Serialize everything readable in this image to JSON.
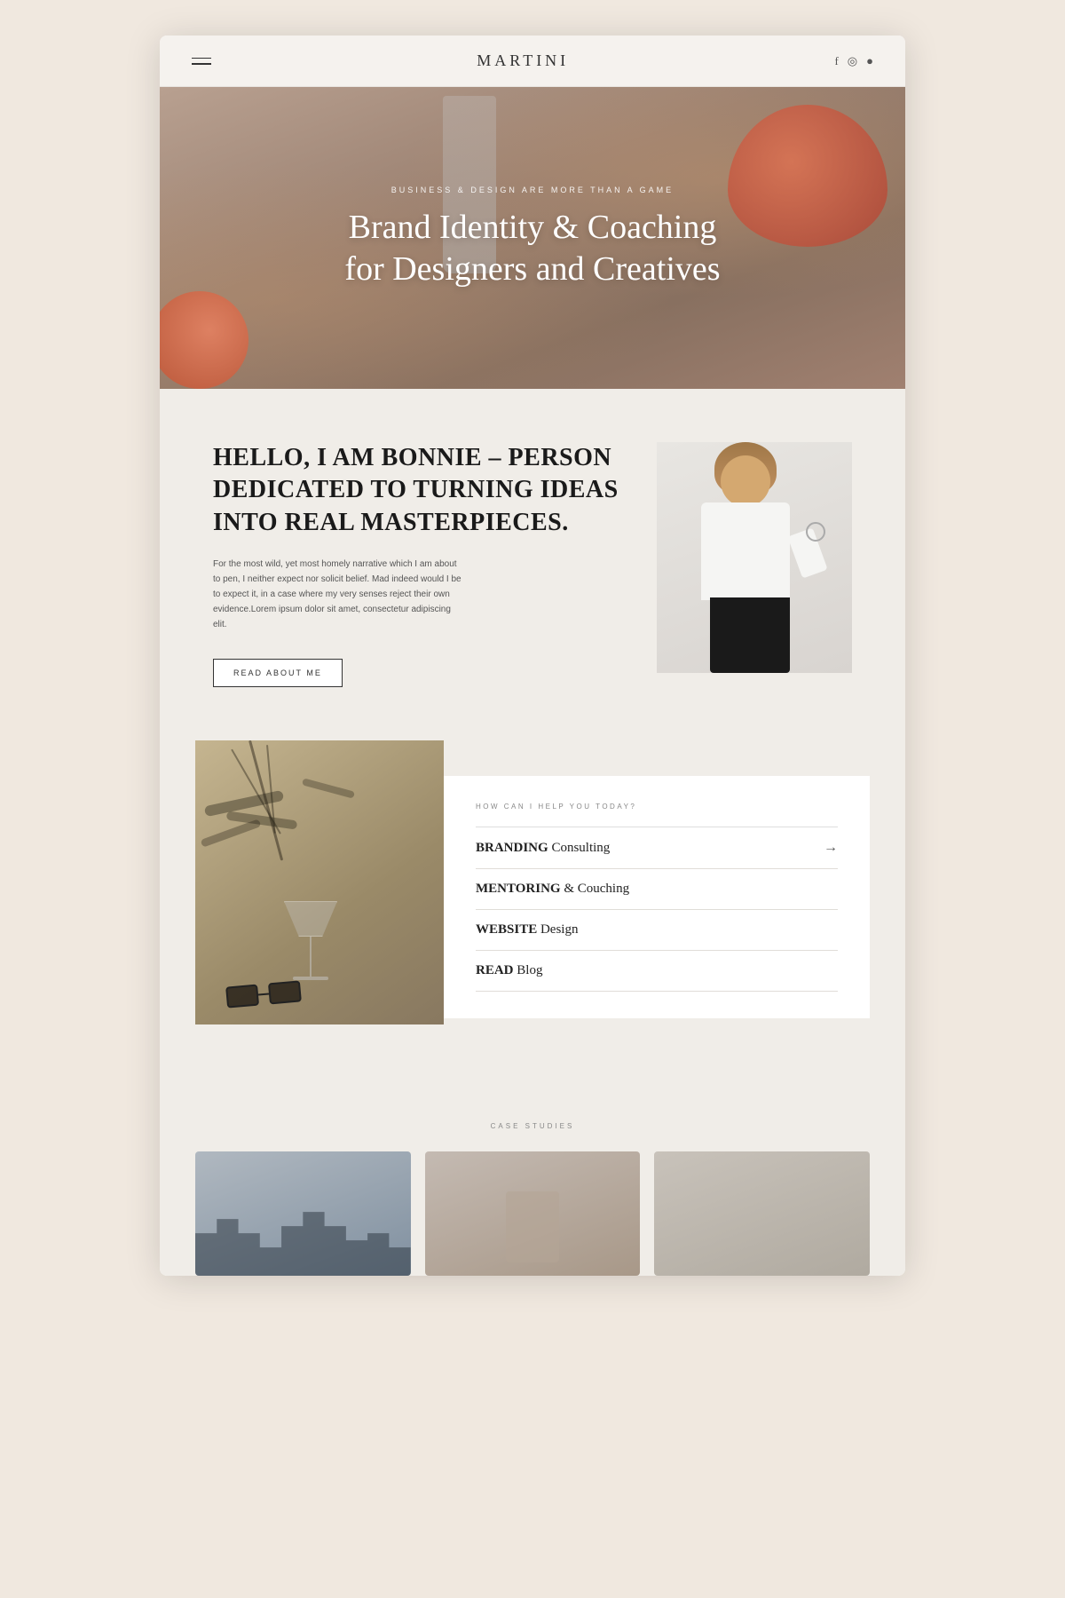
{
  "browser": {
    "background_color": "#f0e8df"
  },
  "navbar": {
    "logo": "MARTINI",
    "social": {
      "facebook": "f",
      "instagram": "📷",
      "pinterest": "●"
    }
  },
  "hero": {
    "subtitle": "BUSINESS & DESIGN ARE MORE THAN A GAME",
    "title": "Brand Identity & Coaching for Designers and Creatives"
  },
  "about": {
    "heading": "HELLO, I AM BONNIE – PERSON DEDICATED TO TURNING IDEAS INTO REAL MASTERPIECES.",
    "body": "For the most wild, yet most homely narrative which I am about to pen, I neither expect nor solicit belief. Mad indeed would I be to expect it, in a case where my very senses reject their own evidence.Lorem ipsum dolor sit amet, consectetur adipiscing elit.",
    "button_label": "READ ABOUT ME"
  },
  "services": {
    "label": "HOW CAN I HELP YOU TODAY?",
    "items": [
      {
        "category": "BRANDING",
        "sub": "Consulting",
        "has_arrow": true
      },
      {
        "category": "MENTORING",
        "sub": "& Couching",
        "has_arrow": false
      },
      {
        "category": "WEBSITE",
        "sub": "Design",
        "has_arrow": false
      },
      {
        "category": "READ",
        "sub": "Blog",
        "has_arrow": false
      }
    ]
  },
  "case_studies": {
    "label": "CASE STUDIES",
    "cards": [
      {
        "id": "card-1",
        "type": "architecture"
      },
      {
        "id": "card-2",
        "type": "interior"
      },
      {
        "id": "card-3",
        "type": "neutral"
      }
    ]
  }
}
